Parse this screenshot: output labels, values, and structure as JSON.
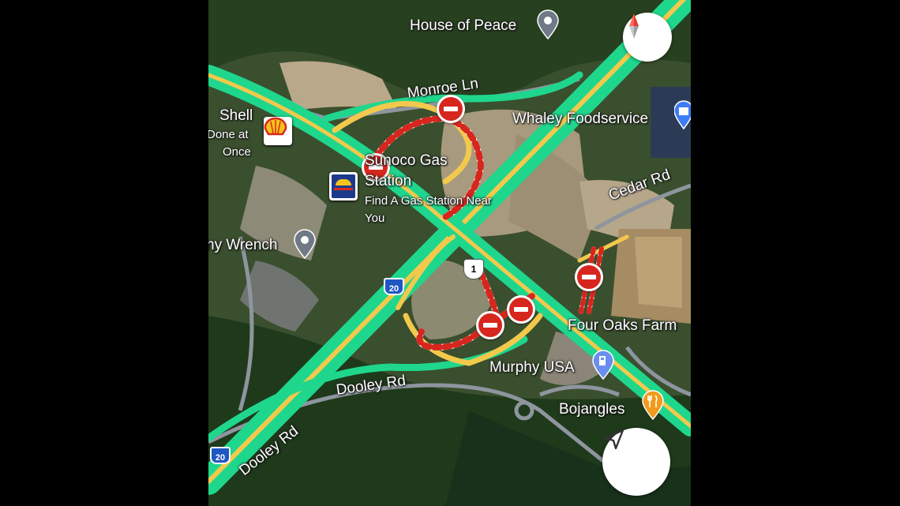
{
  "map": {
    "labels": {
      "house_of_peace": "House of Peace",
      "monroe_ln": "Monroe Ln",
      "shell": "Shell",
      "done_at_once_1": "Done at",
      "done_at_once_2": "Once",
      "whaley": "Whaley Foodservice",
      "sunoco_1": "Sunoco Gas",
      "sunoco_2": "Station",
      "find_gas_1": "Find A Gas Station Near",
      "find_gas_2": "You",
      "cedar_rd": "Cedar Rd",
      "wrench": "ny Wrench",
      "four_oaks": "Four Oaks Farm",
      "murphy": "Murphy USA",
      "dooley_rd_1": "Dooley Rd",
      "dooley_rd_2": "Dooley Rd",
      "bojangles": "Bojangles"
    },
    "shields": {
      "i20_a": "20",
      "i20_b": "20",
      "us1": "1"
    },
    "icons": {
      "compass": "compass-icon",
      "navigate": "navigation-arrow-icon",
      "shell": "shell-logo",
      "sunoco": "sunoco-logo",
      "pin": "map-pin-icon",
      "gas": "gas-pump-icon",
      "restaurant": "fork-knife-icon",
      "shopping": "shopping-bag-icon",
      "closure": "road-closed-icon"
    },
    "colors": {
      "traffic_green": "#1fd68d",
      "road_yellow": "#f2c94c",
      "closure_red": "#d7261e",
      "poi_gray": "#707a86",
      "food_orange": "#f29a1b",
      "shop_blue": "#3d7cf5"
    }
  }
}
